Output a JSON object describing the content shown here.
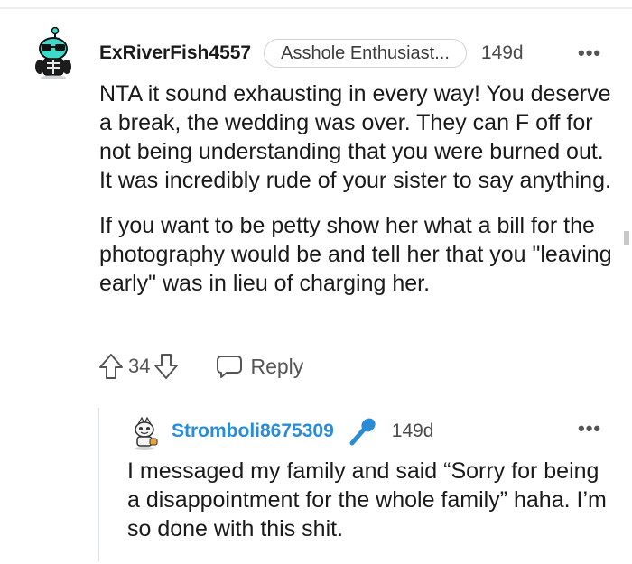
{
  "comment": {
    "username": "ExRiverFish4557",
    "flair": "Asshole Enthusiast...",
    "age": "149d",
    "more": "•••",
    "paragraphs": [
      "NTA it sound exhausting in every way! You deserve a break, the wedding was over. They can F off for not being understanding that you were burned out. It was incredibly rude of your sister to say anything.",
      "If you want to be petty show her what a bill for the photography would be and tell her that you \"leaving early\" was in lieu of charging her."
    ],
    "score": "34",
    "reply_label": "Reply"
  },
  "reply": {
    "username": "Stromboli8675309",
    "age": "149d",
    "more": "•••",
    "text": "I messaged my family and said “Sorry for being a disappointment for the whole family” haha. I’m so done with this shit."
  },
  "colors": {
    "username_reply": "#2a8bd6",
    "mic_icon": "#2a8bd6",
    "avatar_teal": "#3fd9c9"
  },
  "icons": [
    "avatar-icon",
    "upvote-icon",
    "downvote-icon",
    "reply-bubble-icon",
    "microphone-icon",
    "more-options-icon"
  ]
}
